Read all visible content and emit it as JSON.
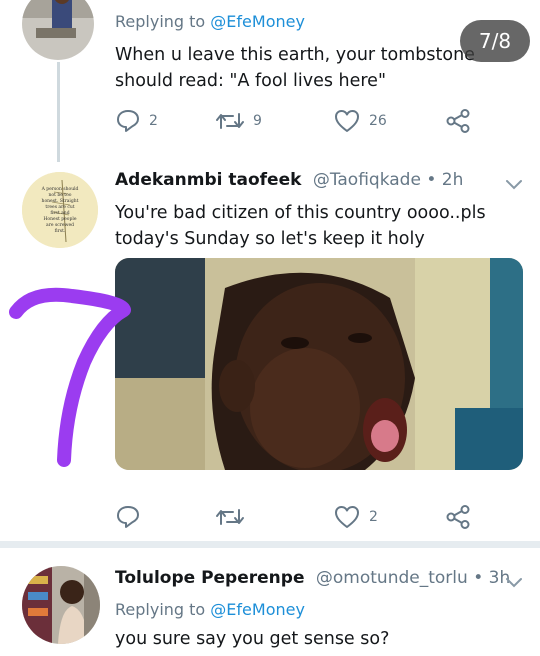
{
  "story_badge": "7/8",
  "overlay_number": "7",
  "tweet1": {
    "replying_prefix": "Replying to",
    "replying_handle": "@EfeMoney",
    "text_line1": "When u leave this earth, your tombstone",
    "text_line2": "should read: \"A fool lives here\"",
    "actions": {
      "reply_count": "2",
      "retweet_count": "9",
      "like_count": "26"
    }
  },
  "tweet2": {
    "name": "Adekanmbi taofeek",
    "handle": "@Taofiqkade",
    "separator": "•",
    "time": "2h",
    "text_line1": "You're bad citizen of this country oooo..pls",
    "text_line2": "today's Sunday so let's keep it holy",
    "avatar_text": "A person should not be too honest. Straight trees are cut first and Honest people are screwed first.",
    "actions": {
      "like_count": "2"
    }
  },
  "tweet3": {
    "name": "Tolulope Peperenpe",
    "handle": "@omotunde_torlu",
    "separator": "•",
    "time": "3h",
    "replying_prefix": "Replying to",
    "replying_handle": "@EfeMoney",
    "text_line1": "you sure say you get sense so?"
  },
  "colors": {
    "link_blue": "#1d8fd8",
    "meta_gray": "#657786",
    "overlay_purple": "#9b3cf0",
    "divider": "#e6ecf0"
  },
  "icons": [
    "reply-icon",
    "retweet-icon",
    "like-icon",
    "share-icon",
    "chevron-down-icon"
  ]
}
